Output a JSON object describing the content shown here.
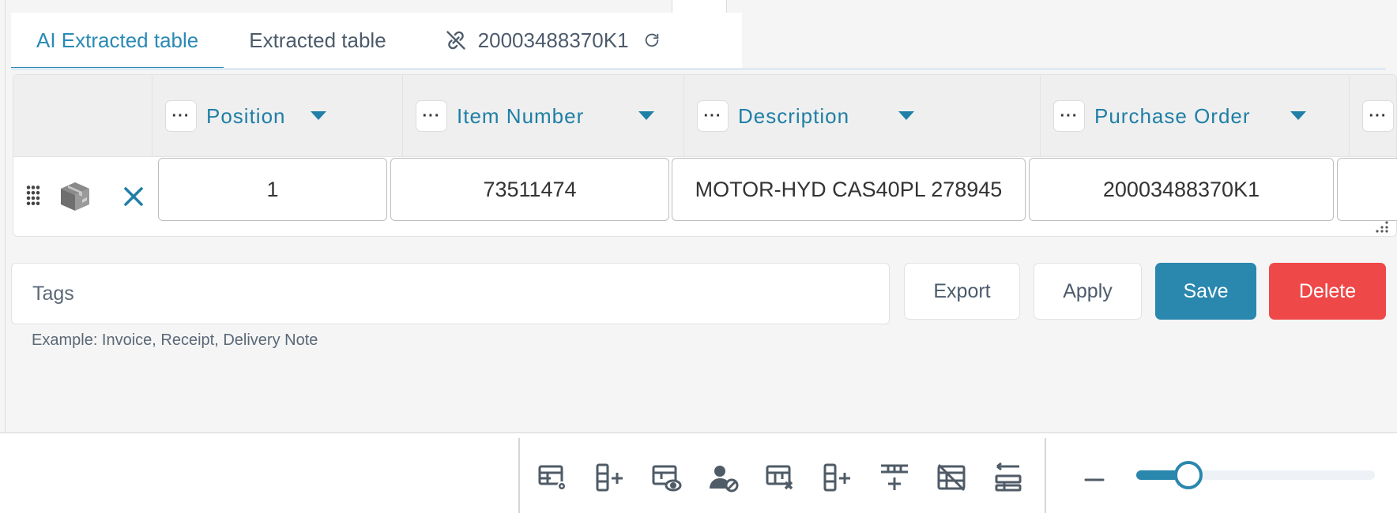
{
  "tabs": {
    "ai_extracted": "AI Extracted table",
    "extracted": "Extracted table",
    "linked_doc": "20003488370K1"
  },
  "table": {
    "columns": [
      {
        "label": "Position"
      },
      {
        "label": "Item Number"
      },
      {
        "label": "Description"
      },
      {
        "label": "Purchase Order"
      }
    ],
    "rows": [
      {
        "position": "1",
        "item_number": "73511474",
        "description": "MOTOR-HYD CAS40PL 278945",
        "purchase_order": "20003488370K1"
      }
    ]
  },
  "tags": {
    "placeholder": "Tags",
    "hint": "Example: Invoice, Receipt, Delivery Note"
  },
  "actions": {
    "export": "Export",
    "apply": "Apply",
    "save": "Save",
    "delete": "Delete"
  },
  "toolbar": {
    "icons": [
      "table-settings-icon",
      "add-column-icon",
      "table-preview-icon",
      "user-block-icon",
      "delete-table-icon",
      "insert-column-icon",
      "add-row-icon",
      "hide-grid-icon",
      "align-rows-icon"
    ],
    "zoom_level": 0.22
  },
  "colors": {
    "accent": "#2a87ae",
    "danger": "#ef4848",
    "header_text": "#1f7fa6"
  }
}
